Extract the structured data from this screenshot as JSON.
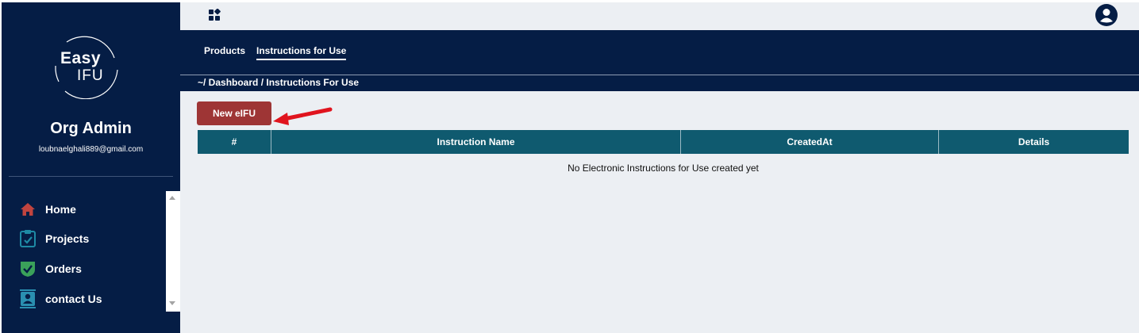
{
  "sidebar": {
    "logo": {
      "word1": "Easy",
      "word2": "IFU"
    },
    "user": {
      "name": "Org Admin",
      "email": "loubnaelghali889@gmail.com"
    },
    "items": [
      {
        "label": "Home",
        "icon": "home-icon",
        "color": "#c0443f"
      },
      {
        "label": "Projects",
        "icon": "clipboard-check-icon",
        "color": "#1e8aa5"
      },
      {
        "label": "Orders",
        "icon": "shield-check-icon",
        "color": "#3aa15a"
      },
      {
        "label": "contact Us",
        "icon": "contact-card-icon",
        "color": "#2a8fb0"
      }
    ]
  },
  "topbar": {
    "apps_icon": "apps-grid-icon",
    "profile_icon": "user-circle-icon"
  },
  "tabs": [
    {
      "label": "Products",
      "active": false
    },
    {
      "label": "Instructions for Use",
      "active": true
    }
  ],
  "breadcrumb": "~/ Dashboard / Instructions For Use",
  "main": {
    "new_button_label": "New eIFU",
    "table": {
      "headers": [
        "#",
        "Instruction Name",
        "CreatedAt",
        "Details"
      ],
      "empty_message": "No Electronic Instructions for Use created yet"
    }
  },
  "colors": {
    "navy": "#051d45",
    "teal_header": "#0f5a6f",
    "button_red": "#9e3535",
    "annotation_arrow": "#e0141e",
    "content_bg": "#eceff3"
  }
}
